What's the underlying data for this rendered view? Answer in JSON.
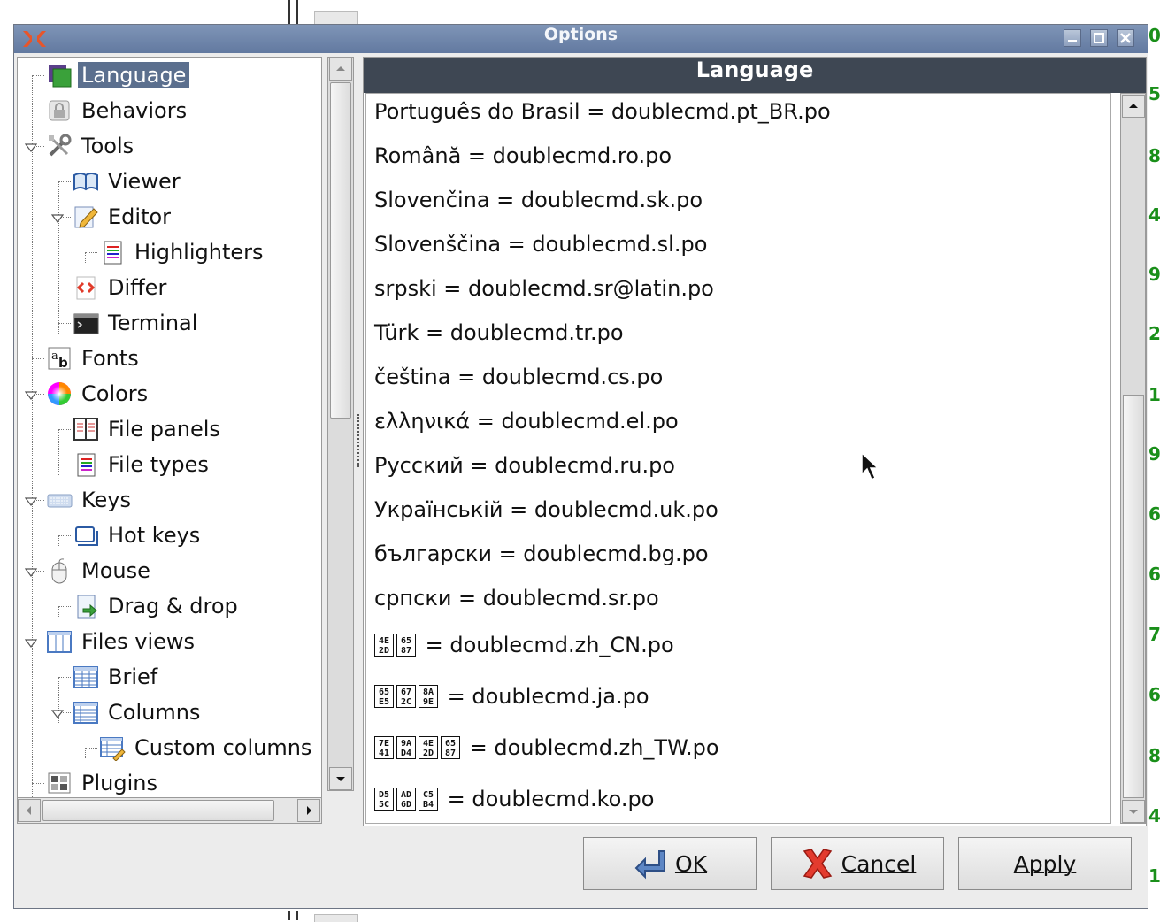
{
  "window": {
    "title": "Options",
    "controls": [
      "minimize",
      "maximize",
      "close"
    ]
  },
  "background": {
    "side_digits": [
      "0",
      "5",
      "8",
      "4",
      "9",
      "2",
      "1",
      "9",
      "6",
      "6",
      "7",
      "6",
      "8",
      "4",
      "1"
    ]
  },
  "tree": {
    "items": [
      {
        "label": "Language",
        "icon": "language-icon",
        "level": 0,
        "selected": true
      },
      {
        "label": "Behaviors",
        "icon": "lock-icon",
        "level": 0
      },
      {
        "label": "Tools",
        "icon": "tools-icon",
        "level": 0,
        "expanded": true
      },
      {
        "label": "Viewer",
        "icon": "book-icon",
        "level": 1
      },
      {
        "label": "Editor",
        "icon": "pencil-icon",
        "level": 1,
        "expanded": true
      },
      {
        "label": "Highlighters",
        "icon": "document-icon",
        "level": 2
      },
      {
        "label": "Differ",
        "icon": "code-diff-icon",
        "level": 1
      },
      {
        "label": "Terminal",
        "icon": "terminal-icon",
        "level": 1
      },
      {
        "label": "Fonts",
        "icon": "font-icon",
        "level": 0
      },
      {
        "label": "Colors",
        "icon": "color-wheel-icon",
        "level": 0,
        "expanded": true
      },
      {
        "label": "File panels",
        "icon": "panels-icon",
        "level": 1
      },
      {
        "label": "File types",
        "icon": "document-icon",
        "level": 1
      },
      {
        "label": "Keys",
        "icon": "keyboard-icon",
        "level": 0,
        "expanded": true
      },
      {
        "label": "Hot keys",
        "icon": "hotkey-icon",
        "level": 1
      },
      {
        "label": "Mouse",
        "icon": "mouse-icon",
        "level": 0,
        "expanded": true
      },
      {
        "label": "Drag & drop",
        "icon": "drag-drop-icon",
        "level": 1
      },
      {
        "label": "Files views",
        "icon": "files-view-icon",
        "level": 0,
        "expanded": true
      },
      {
        "label": "Brief",
        "icon": "brief-view-icon",
        "level": 1
      },
      {
        "label": "Columns",
        "icon": "columns-view-icon",
        "level": 1,
        "expanded": true
      },
      {
        "label": "Custom columns",
        "icon": "custom-columns-icon",
        "level": 2
      },
      {
        "label": "Plugins",
        "icon": "plugins-icon",
        "level": 0
      }
    ]
  },
  "panel": {
    "header": "Language",
    "languages": [
      {
        "text": "Português do Brasil = doublecmd.pt_BR.po"
      },
      {
        "text": "Română = doublecmd.ro.po"
      },
      {
        "text": "Slovenčina = doublecmd.sk.po"
      },
      {
        "text": "Slovenščina = doublecmd.sl.po"
      },
      {
        "text": "srpski = doublecmd.sr@latin.po"
      },
      {
        "text": "Türk = doublecmd.tr.po"
      },
      {
        "text": "čeština = doublecmd.cs.po"
      },
      {
        "text": "ελληνικά = doublecmd.el.po"
      },
      {
        "text": "Русский = doublecmd.ru.po"
      },
      {
        "text": "Українській = doublecmd.uk.po"
      },
      {
        "text": "български = doublecmd.bg.po"
      },
      {
        "text": "српски = doublecmd.sr.po"
      },
      {
        "glyphs": [
          [
            "4E",
            "2D"
          ],
          [
            "65",
            "87"
          ]
        ],
        "text": " = doublecmd.zh_CN.po"
      },
      {
        "glyphs": [
          [
            "65",
            "E5"
          ],
          [
            "67",
            "2C"
          ],
          [
            "8A",
            "9E"
          ]
        ],
        "text": " = doublecmd.ja.po"
      },
      {
        "glyphs": [
          [
            "7E",
            "41"
          ],
          [
            "9A",
            "D4"
          ],
          [
            "4E",
            "2D"
          ],
          [
            "65",
            "87"
          ]
        ],
        "text": " = doublecmd.zh_TW.po"
      },
      {
        "glyphs": [
          [
            "D5",
            "5C"
          ],
          [
            "AD",
            "6D"
          ],
          [
            "C5",
            "B4"
          ]
        ],
        "text": " = doublecmd.ko.po"
      }
    ]
  },
  "buttons": {
    "ok": {
      "label": "OK",
      "icon": "ok-arrow-icon"
    },
    "cancel": {
      "label": "Cancel",
      "icon": "cancel-x-icon"
    },
    "apply": {
      "label": "Apply"
    }
  },
  "colors": {
    "titlebar": "#6f86ab",
    "header": "#3e4753",
    "selection": "#5b6f8e"
  }
}
